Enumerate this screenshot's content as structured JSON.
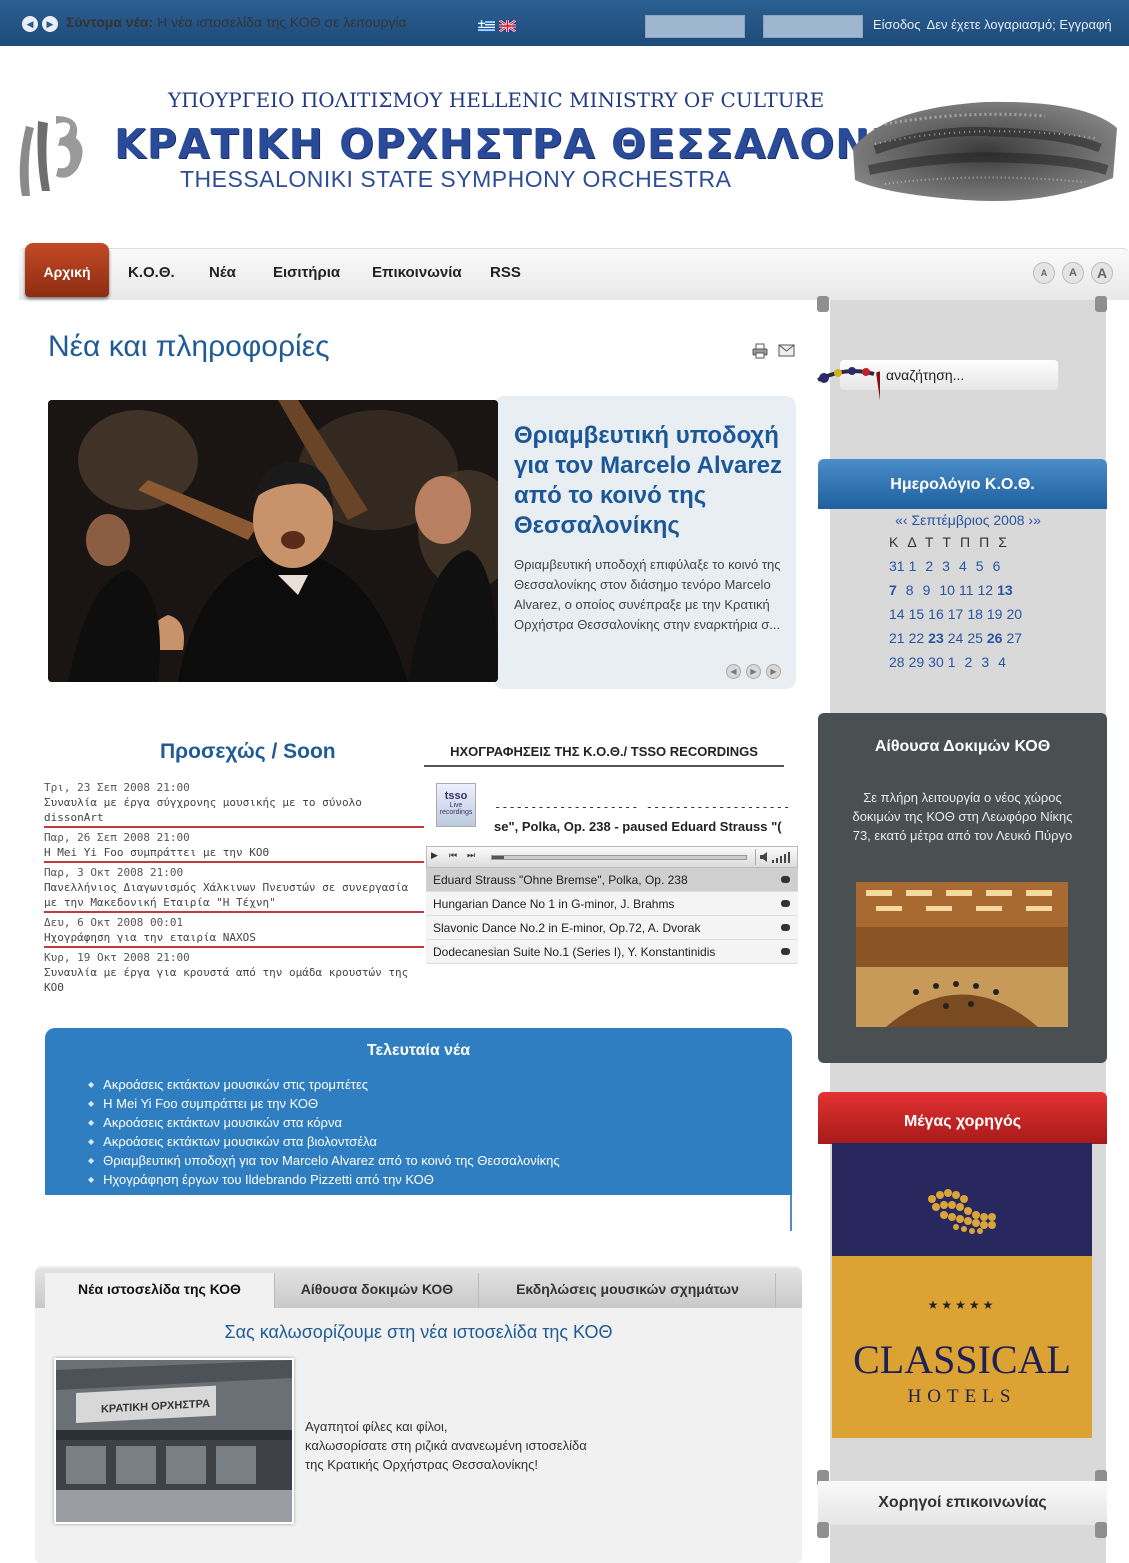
{
  "topbar": {
    "prev_icon": "chevron-left-icon",
    "next_icon": "chevron-right-icon",
    "newsflash_label": "Σύντομα νέα:",
    "newsflash_text": "Η νέα ιστοσελίδα της ΚΟΘ σε λειτουργία",
    "login_link": "Είσοδος",
    "register_link": "Δεν έχετε λογαριασμό; Εγγραφή"
  },
  "header": {
    "ministry": "ΥΠΟΥΡΓΕΙΟ ΠΟΛΙΤΙΣΜΟΥ HELLENIC  MINISTRY OF CULTURE",
    "orchestra_gr": "ΚΡΑΤΙΚΗ ΟΡΧΗΣΤΡΑ ΘΕΣΣΑΛΟΝΙΚΗΣ",
    "orchestra_en": "THESSALONIKI STATE SYMPHONY ORCHESTRA"
  },
  "nav": {
    "home": "Αρχική",
    "items": [
      "Κ.Ο.Θ.",
      "Νέα",
      "Εισιτήρια",
      "Επικοινωνία",
      "RSS"
    ],
    "font_sizes": [
      "A",
      "A",
      "A"
    ]
  },
  "main": {
    "title": "Νέα και πληροφορίες",
    "featured": {
      "title": "Θριαμβευτική υποδοχή για τον Marcelo Alvarez από το κοινό της Θεσσαλονίκης",
      "text": "Θριαμβευτική υποδοχή επιφύλαξε το κοινό της Θεσσαλονίκης στον διάσημο τενόρο Marcelo Alvarez, ο οποίος συνέπραξε με την Κρατική Ορχήστρα Θεσσαλονίκης στην εναρκτήρια σ..."
    },
    "soon": {
      "title": "Προσεχώς / Soon",
      "items": [
        {
          "date": "Τρι, 23 Σεπ 2008 21:00",
          "desc": "Συναυλία με έργα σύγχρονης μουσικής με το σύνολο dissonArt"
        },
        {
          "date": "Παρ, 26 Σεπ 2008 21:00",
          "desc": "Η Mei Yi Foo συμπράττει με την ΚΟΘ"
        },
        {
          "date": "Παρ, 3 Οκτ 2008 21:00",
          "desc": "Πανελλήνιος Διαγωνισμός Χάλκινων Πνευστών σε συνεργασία με την Μακεδονική Εταιρία \"Η Τέχνη\""
        },
        {
          "date": "Δευ, 6 Οκτ 2008 00:01",
          "desc": "Ηχογράφηση για την εταιρία NAXOS"
        },
        {
          "date": "Κυρ, 19 Οκτ 2008 21:00",
          "desc": "Συναυλία με έργα για κρουστά από την ομάδα κρουστών της ΚΟΘ"
        }
      ]
    },
    "recordings": {
      "title": "ΗΧΟΓΡΑΦΗΣΕΙΣ ΤΗΣ Κ.Ο.Θ./ TSSO RECORDINGS",
      "logo_line1": "tsso",
      "logo_line2": "Live recordings",
      "dashes": "--------------------  --------------------",
      "now_playing": "se\", Polka, Op. 238 - paused   Eduard Strauss \"(",
      "tracks": [
        "Eduard Strauss \"Ohne Bremse\", Polka, Op. 238",
        "Hungarian Dance No 1 in G-minor, J. Brahms",
        "Slavonic Dance No.2 in E-minor, Op.72, A. Dvorak",
        "Dodecanesian Suite No.1 (Series I), Y. Konstantinidis"
      ]
    },
    "latest": {
      "title": "Τελευταία νέα",
      "items": [
        "Ακροάσεις εκτάκτων μουσικών στις τρομπέτες",
        "Η Mei Yi Foo συμπράττει με την ΚΟΘ",
        "Ακροάσεις εκτάκτων μουσικών στα κόρνα",
        "Ακροάσεις εκτάκτων μουσικών στα βιολοντσέλα",
        "Θριαμβευτική υποδοχή για τον Marcelo Alvarez από το κοινό της Θεσσαλονίκης",
        "Ηχογράφηση έργων του Ildebrando Pizzetti από την ΚΟΘ"
      ]
    },
    "tabs": {
      "labels": [
        "Νέα ιστοσελίδα της ΚΟΘ",
        "Αίθουσα δοκιμών ΚΟΘ",
        "Εκδηλώσεις μουσικών σχημάτων"
      ],
      "heading": "Σας καλωσορίζουμε στη νέα ιστοσελίδα της ΚΟΘ",
      "text": [
        "Αγαπητοί φίλες και φίλοι,",
        "καλωσορίσατε στη ριζικά ανανεωμένη ιστοσελίδα",
        "της Κρατικής Ορχήστρας Θεσσαλονίκης!"
      ]
    }
  },
  "sidebar": {
    "search_placeholder": "αναζήτηση...",
    "calendar": {
      "title": "Ημερολόγιο Κ.Ο.Θ.",
      "month": "«‹  Σεπτέμβριος 2008  ›»",
      "dow": "ΚΔΤΤΠΠΣ",
      "weeks": [
        [
          "31",
          "1",
          "2",
          "3",
          "4",
          "5",
          "6"
        ],
        [
          "7",
          "8",
          "9",
          "10",
          "11",
          "12",
          "13"
        ],
        [
          "14",
          "15",
          "16",
          "17",
          "18",
          "19",
          "20"
        ],
        [
          "21",
          "22",
          "23",
          "24",
          "25",
          "26",
          "27"
        ],
        [
          "28",
          "29",
          "30",
          "1",
          "2",
          "3",
          "4"
        ]
      ]
    },
    "hall": {
      "title": "Αίθουσα Δοκιμών ΚΟΘ",
      "text": "Σε πλήρη λειτουργία ο νέος χώρος δοκιμών της ΚΟΘ στη Λεωφόρο Νίκης 73, εκατό μέτρα από τον Λευκό Πύργο"
    },
    "sponsor": {
      "title": "Μέγας χορηγός",
      "stars": "★★★★★",
      "brand": "CLASSICAL",
      "sub": "HOTELS"
    },
    "media": "Χορηγοί επικοινωνίας"
  },
  "colors": {
    "topbar": "#2c5f92",
    "link_blue": "#1f5b96",
    "calendar_blue": "#2855a3",
    "nav_red": "#c24a26",
    "sponsor_red": "#e33232",
    "sponsor_gold": "#dca233"
  }
}
